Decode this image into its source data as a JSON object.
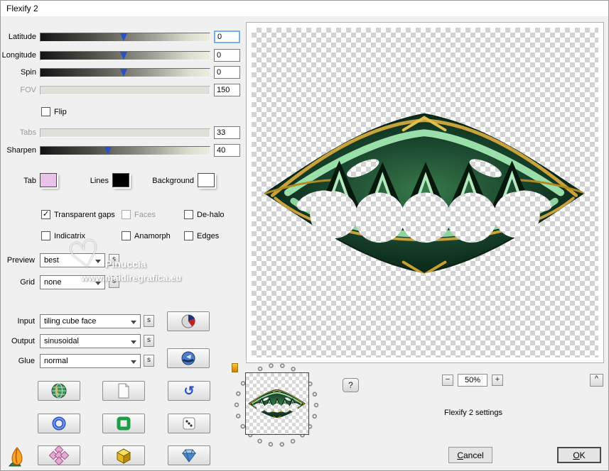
{
  "window": {
    "title": "Flexify 2"
  },
  "sliders": {
    "latitude": {
      "label": "Latitude",
      "value": "0"
    },
    "longitude": {
      "label": "Longitude",
      "value": "0"
    },
    "spin": {
      "label": "Spin",
      "value": "0"
    },
    "fov": {
      "label": "FOV",
      "value": "150"
    },
    "tabs": {
      "label": "Tabs",
      "value": "33"
    },
    "sharpen": {
      "label": "Sharpen",
      "value": "40"
    }
  },
  "flip": {
    "label": "Flip"
  },
  "swatches": {
    "tab": {
      "label": "Tab",
      "color": "#e9c2e9"
    },
    "lines": {
      "label": "Lines",
      "color": "#000000"
    },
    "background": {
      "label": "Background",
      "color": "#ffffff"
    }
  },
  "checkboxes": {
    "transparent_gaps": {
      "label": "Transparent gaps",
      "checked": true
    },
    "faces": {
      "label": "Faces",
      "checked": false
    },
    "dehalo": {
      "label": "De-halo",
      "checked": false
    },
    "indicatrix": {
      "label": "Indicatrix",
      "checked": false
    },
    "anamorph": {
      "label": "Anamorph",
      "checked": false
    },
    "edges": {
      "label": "Edges",
      "checked": false
    }
  },
  "dropdowns": {
    "preview": {
      "label": "Preview",
      "value": "best"
    },
    "grid": {
      "label": "Grid",
      "value": "none"
    },
    "input": {
      "label": "Input",
      "value": "tiling cube face"
    },
    "output": {
      "label": "Output",
      "value": "sinusoidal"
    },
    "glue": {
      "label": "Glue",
      "value": "normal"
    }
  },
  "small_button_glyph": "s",
  "check_glyph": "✓",
  "undo_glyph": "↺",
  "help_label": "?",
  "zoom": {
    "minus": "−",
    "level": "50%",
    "plus": "+",
    "collapse": "^"
  },
  "settings_caption": "Flexify 2 settings",
  "actions": {
    "cancel_initial": "C",
    "cancel_rest": "ancel",
    "ok_initial": "O",
    "ok_rest": "K"
  },
  "watermark": {
    "heart": "♡",
    "name": "Pinuccia",
    "site": "www.maidiregrafica.eu"
  },
  "accent_colors": {
    "marker_blue": "#2a52c8",
    "focus_blue": "#7ab0e8",
    "ornament_green": "#16402a",
    "ornament_gold": "#caa23b"
  }
}
